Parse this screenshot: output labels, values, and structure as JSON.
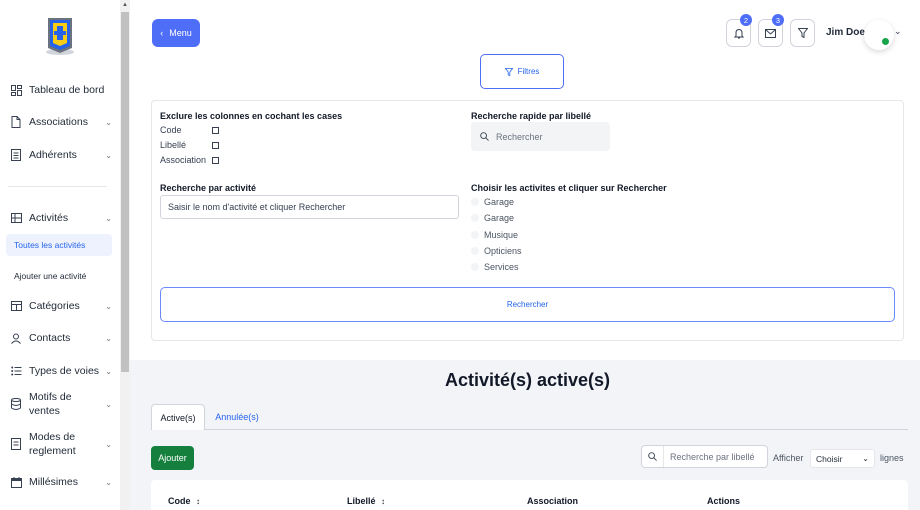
{
  "sidebar": {
    "items": [
      {
        "label": "Tableau de bord",
        "icon": "dashboard-icon",
        "chevron": false
      },
      {
        "label": "Associations",
        "icon": "document-icon",
        "chevron": true
      },
      {
        "label": "Adhérents",
        "icon": "list-icon",
        "chevron": true
      },
      {
        "label": "Activités",
        "icon": "grid-icon",
        "chevron": true
      },
      {
        "label": "Catégories",
        "icon": "table-icon",
        "chevron": true
      },
      {
        "label": "Contacts",
        "icon": "user-icon",
        "chevron": true
      },
      {
        "label": "Types de voies",
        "icon": "list-bullet-icon",
        "chevron": true
      },
      {
        "label": "Motifs de ventes",
        "icon": "database-icon",
        "chevron": true
      },
      {
        "label": "Modes de reglement",
        "icon": "file-icon",
        "chevron": true
      },
      {
        "label": "Millésimes",
        "icon": "calendar-icon",
        "chevron": true
      }
    ],
    "sub_items": [
      {
        "label": "Toutes les activités",
        "active": true
      },
      {
        "label": "Ajouter une activité",
        "active": false
      }
    ]
  },
  "header": {
    "menu_label": "Menu",
    "notifications_count": "2",
    "messages_count": "3",
    "user_name": "Jim Doe",
    "status_color": "#16a34a"
  },
  "filters_button": "Filtres",
  "filter_panel": {
    "exclude_title": "Exclure les colonnes en cochant les cases",
    "exclude_options": [
      "Code",
      "Libellé",
      "Association"
    ],
    "quick_search_title": "Recherche rapide par libellé",
    "quick_search_placeholder": "Rechercher",
    "activity_search_title": "Recherche par activité",
    "activity_search_placeholder": "Saisir le nom d'activité et cliquer Rechercher",
    "choose_title": "Choisir les activites et cliquer sur Rechercher",
    "activity_options": [
      "Garage",
      "Garage",
      "Musique",
      "Opticiens",
      "Services"
    ],
    "search_button": "Rechercher"
  },
  "list": {
    "title": "Activité(s) active(s)",
    "tabs": [
      {
        "label": "Active(s)",
        "active": true
      },
      {
        "label": "Annulée(s)",
        "active": false
      }
    ],
    "add_button": "Ajouter",
    "search_placeholder": "Recherche par libellé",
    "show_label": "Afficher",
    "page_size_value": "Choisir",
    "rows_label": "lignes",
    "columns": [
      "Code",
      "Libellé",
      "Association",
      "Actions"
    ]
  },
  "colors": {
    "primary": "#4f6ef7",
    "link": "#2563eb",
    "success": "#15803d"
  }
}
